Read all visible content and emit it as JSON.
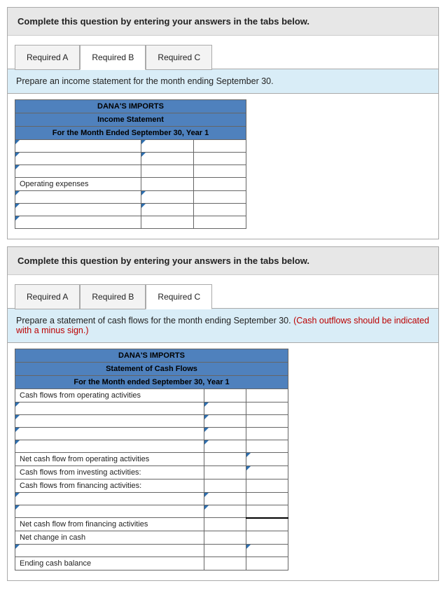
{
  "section1": {
    "instruction": "Complete this question by entering your answers in the tabs below.",
    "tabs": {
      "a": "Required A",
      "b": "Required B",
      "c": "Required C"
    },
    "prompt": "Prepare an income statement for the month ending September 30.",
    "table": {
      "title": "DANA'S IMPORTS",
      "subtitle": "Income Statement",
      "period": "For the Month Ended September 30, Year 1",
      "operating_expenses": "Operating expenses"
    }
  },
  "section2": {
    "instruction": "Complete this question by entering your answers in the tabs below.",
    "tabs": {
      "a": "Required A",
      "b": "Required B",
      "c": "Required C"
    },
    "prompt_main": "Prepare a statement of cash flows for the month ending September 30. ",
    "prompt_red": "(Cash outflows should be indicated with a minus sign.)",
    "table": {
      "title": "DANA'S IMPORTS",
      "subtitle": "Statement of Cash Flows",
      "period": "For the Month ended September 30, Year 1",
      "rows": {
        "cf_op": "Cash flows from operating activities",
        "net_op": "Net cash flow from operating activities",
        "cf_inv": "Cash flows from investing activities:",
        "cf_fin": "Cash flows from financing activities:",
        "net_fin": "Net cash flow from financing activities",
        "net_change": "Net change in cash",
        "ending": "Ending cash balance"
      }
    }
  }
}
